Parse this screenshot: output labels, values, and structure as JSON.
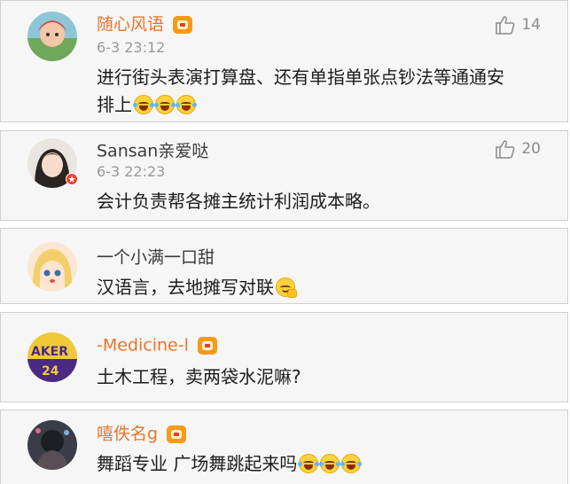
{
  "theme": {
    "vip_name_color": "#e8742c",
    "plain_name_color": "#3b3b3b",
    "like_color": "#8c8c8c",
    "vip_badge_color": "#f29c18"
  },
  "comments": [
    {
      "username": "随心风语",
      "vip": true,
      "time": "6-3 23:12",
      "likes": "14",
      "text_line1": "进行街头表演打算盘、还有单指单张点钞法等通通安",
      "text_line2": "排上",
      "emojis": [
        "laugh-cry-emoji",
        "laugh-cry-emoji",
        "laugh-cry-emoji"
      ]
    },
    {
      "username": "Sansan亲爱哒",
      "vip": false,
      "time": "6-3 22:23",
      "likes": "20",
      "text_line1": "会计负责帮各摊主统计利润成本略。"
    },
    {
      "username": "一个小满一口甜",
      "vip": false,
      "text_line1": "汉语言，去地摊写对联",
      "emojis": [
        "smirk-emoji"
      ]
    },
    {
      "username": "-Medicine-l",
      "vip": true,
      "text_line1": "土木工程，卖两袋水泥嘛?"
    },
    {
      "username": "嘻佚名g",
      "vip": true,
      "text_line1": "舞蹈专业 广场舞跳起来吗",
      "emojis": [
        "laugh-cry-emoji",
        "laugh-cry-emoji",
        "laugh-cry-emoji"
      ]
    }
  ]
}
